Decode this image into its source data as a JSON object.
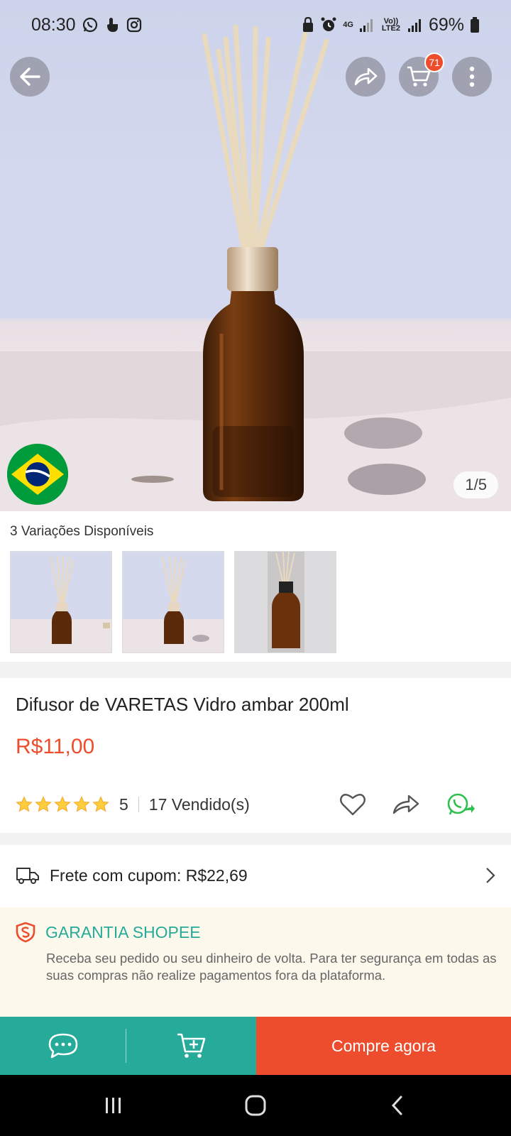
{
  "status_bar": {
    "time": "08:30",
    "network_4g": "4G",
    "network_volte": "Vo)) LTE2",
    "battery": "69%",
    "left_icons": [
      "whatsapp-icon",
      "touch-icon",
      "instagram-icon"
    ],
    "right_icons": [
      "lock-icon",
      "alarm-icon",
      "signal-icon",
      "signal-icon-2",
      "battery-icon"
    ]
  },
  "header": {
    "back_icon": "arrow-left-icon",
    "share_icon": "share-icon",
    "cart_icon": "cart-icon",
    "cart_count": "71",
    "more_icon": "more-vertical-icon"
  },
  "gallery": {
    "counter": "1/5",
    "origin_flag": "brazil-flag"
  },
  "variations": {
    "label": "3 Variações Disponíveis",
    "thumbnails": [
      "variation-1",
      "variation-2",
      "variation-3"
    ]
  },
  "product": {
    "title": "Difusor de VARETAS Vidro ambar 200ml",
    "price": "R$11,00",
    "rating": "5",
    "stars": 5,
    "sold": "17 Vendido(s)",
    "action_icons": [
      "heart-icon",
      "share-icon",
      "whatsapp-share-icon"
    ]
  },
  "shipping": {
    "text": "Frete com cupom: R$22,69",
    "icon": "truck-icon"
  },
  "guarantee": {
    "title": "GARANTIA SHOPEE",
    "text": "Receba seu pedido ou seu dinheiro de volta. Para ter segurança em todas as suas compras não realize pagamentos fora da plataforma."
  },
  "bottom_bar": {
    "chat_icon": "chat-icon",
    "add_to_cart_icon": "add-to-cart-icon",
    "buy_label": "Compre agora"
  },
  "colors": {
    "accent": "#ee4d2d",
    "teal": "#26aa99",
    "guarantee_bg": "#fdf8ec"
  }
}
